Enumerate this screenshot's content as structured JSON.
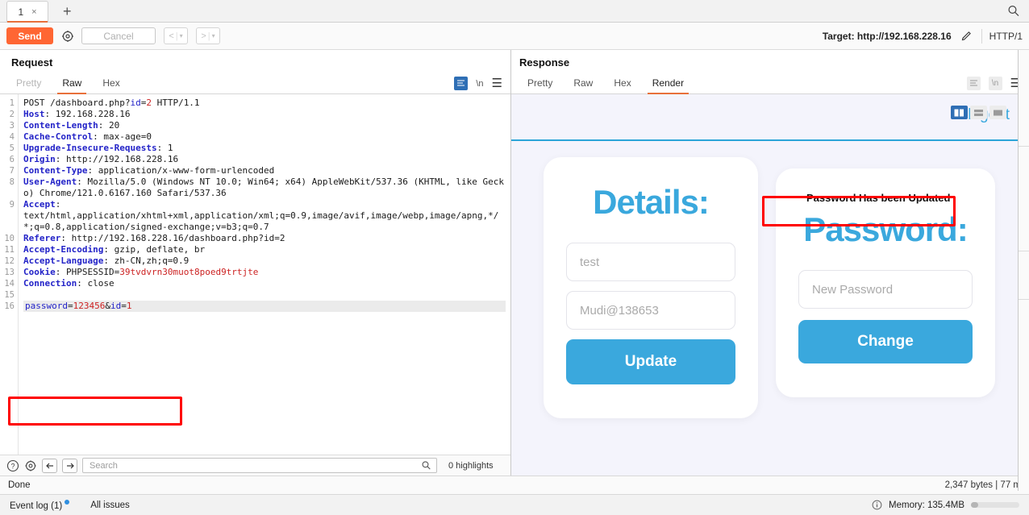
{
  "app": {
    "tabs": [
      {
        "label": "1",
        "close": "×"
      }
    ],
    "add_tab_label": "+",
    "search_icon": "search-icon"
  },
  "toolbar": {
    "send_label": "Send",
    "settings_icon": "gear-icon",
    "cancel_label": "Cancel",
    "prev_label": "<",
    "next_label": ">",
    "caret": "▾",
    "target_label": "Target: http://192.168.228.16",
    "edit_icon": "pencil-icon",
    "protocol": "HTTP/1"
  },
  "request": {
    "title": "Request",
    "tabs": [
      {
        "label": "Pretty",
        "active": false,
        "dim": true
      },
      {
        "label": "Raw",
        "active": true,
        "dim": false
      },
      {
        "label": "Hex",
        "active": false,
        "dim": false
      }
    ],
    "icons": {
      "wrap": "word-wrap-icon",
      "newline": "\\n",
      "menu": "hamburger-menu-icon"
    },
    "lines": [
      {
        "n": "1",
        "html": "POST /dashboard.php?<span class=\"bl\">id</span>=<span class=\"rd\">2</span> HTTP/1.1"
      },
      {
        "n": "2",
        "html": "<span class=\"hk\">Host</span>: 192.168.228.16"
      },
      {
        "n": "3",
        "html": "<span class=\"hk\">Content-Length</span>: 20"
      },
      {
        "n": "4",
        "html": "<span class=\"hk\">Cache-Control</span>: max-age=0"
      },
      {
        "n": "5",
        "html": "<span class=\"hk\">Upgrade-Insecure-Requests</span>: 1"
      },
      {
        "n": "6",
        "html": "<span class=\"hk\">Origin</span>: http://192.168.228.16"
      },
      {
        "n": "7",
        "html": "<span class=\"hk\">Content-Type</span>: application/x-www-form-urlencoded"
      },
      {
        "n": "8",
        "html": "<span class=\"hk\">User-Agent</span>: Mozilla/5.0 (Windows NT 10.0; Win64; x64) AppleWebKit/537.36 (KHTML, like Gecko) Chrome/121.0.6167.160 Safari/537.36"
      },
      {
        "n": "9",
        "html": "<span class=\"hk\">Accept</span>:\ntext/html,application/xhtml+xml,application/xml;q=0.9,image/avif,image/webp,image/apng,*/*;q=0.8,application/signed-exchange;v=b3;q=0.7"
      },
      {
        "n": "10",
        "html": "<span class=\"hk\">Referer</span>: http://192.168.228.16/dashboard.php?id=2"
      },
      {
        "n": "11",
        "html": "<span class=\"hk\">Accept-Encoding</span>: gzip, deflate, br"
      },
      {
        "n": "12",
        "html": "<span class=\"hk\">Accept-Language</span>: zh-CN,zh;q=0.9"
      },
      {
        "n": "13",
        "html": "<span class=\"hk\">Cookie</span>: PHPSESSID=<span class=\"rd\">39tvdvrn30muot8poed9trtjte</span>"
      },
      {
        "n": "14",
        "html": "<span class=\"hk\">Connection</span>: close"
      },
      {
        "n": "15",
        "html": ""
      },
      {
        "n": "16",
        "html": "<span class=\"body-line\"><span class=\"bl\">password</span>=<span class=\"rd\">123456</span>&<span class=\"bl\">id</span>=<span class=\"rd\">1</span></span>"
      }
    ],
    "findbar": {
      "help_icon": "help-icon",
      "settings_icon": "gear-icon",
      "back_icon": "arrow-left-icon",
      "forward_icon": "arrow-right-icon",
      "search_placeholder": "Search",
      "search_value": "",
      "highlights": "0 highlights"
    }
  },
  "response": {
    "title": "Response",
    "tabs": [
      {
        "label": "Pretty",
        "active": false
      },
      {
        "label": "Raw",
        "active": false
      },
      {
        "label": "Hex",
        "active": false
      },
      {
        "label": "Render",
        "active": true
      }
    ],
    "icons": {
      "wrap": "word-wrap-icon",
      "newline": "\\n",
      "menu": "hamburger-menu-icon"
    },
    "layout_buttons": [
      {
        "name": "side-by-side-layout-button",
        "active": true
      },
      {
        "name": "stacked-layout-button",
        "active": false
      },
      {
        "name": "single-pane-layout-button",
        "active": false
      }
    ],
    "rendered": {
      "nav": {
        "logout": "logout"
      },
      "details_card": {
        "heading": "Details:",
        "fields": [
          {
            "name": "username-field",
            "placeholder": "test"
          },
          {
            "name": "email-field",
            "placeholder": "Mudi@138653"
          }
        ],
        "button": "Update"
      },
      "password_card": {
        "flash": "Password Has been Updated",
        "heading": "Password:",
        "fields": [
          {
            "name": "new-password-field",
            "placeholder": "New Password"
          }
        ],
        "button": "Change"
      }
    }
  },
  "annotations": {
    "body_box_color": "#ff0000",
    "flash_box_color": "#ff0000"
  },
  "status": {
    "left": "Done",
    "right": "2,347 bytes | 77 m"
  },
  "footer": {
    "event_log": "Event log (1)",
    "all_issues": "All issues",
    "info_icon": "info-icon",
    "memory": "Memory: 135.4MB"
  },
  "colors": {
    "accent_orange": "#ff6633",
    "brand_blue": "#3aa8dd",
    "annotation_red": "#ff0000",
    "page_bg": "#f4f4fc"
  }
}
